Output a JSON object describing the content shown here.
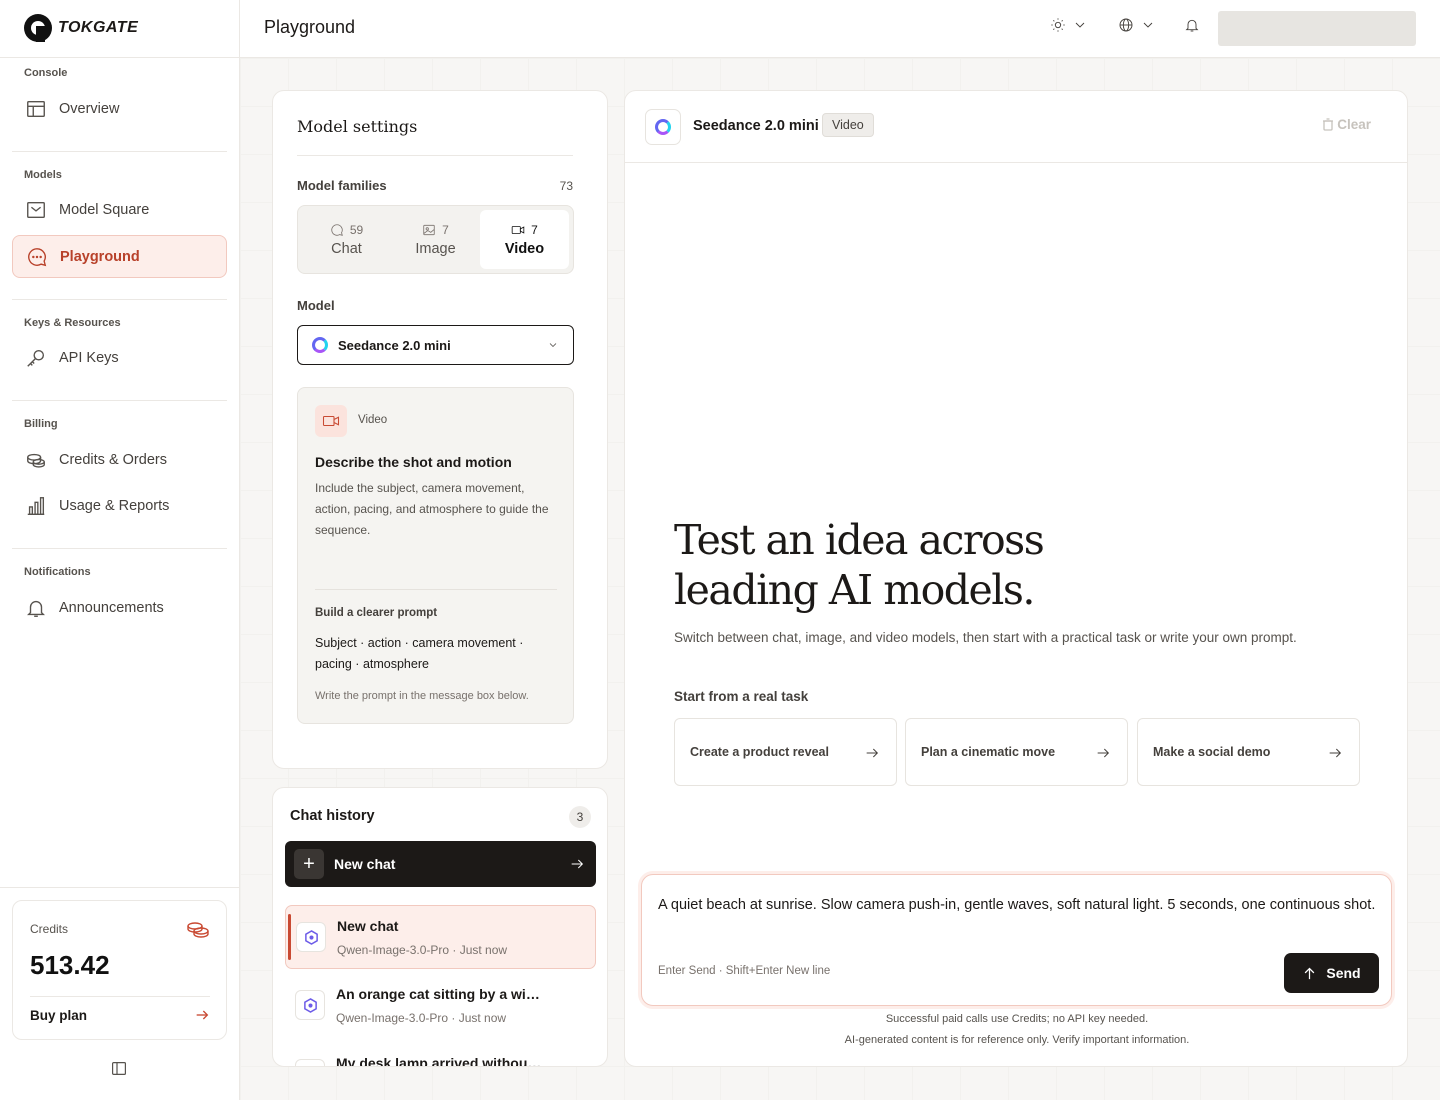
{
  "app": {
    "brand": "TOKGATE"
  },
  "sidebar": {
    "groups": [
      {
        "label": "Console",
        "items": [
          {
            "label": "Overview",
            "icon": "layout-icon"
          }
        ]
      },
      {
        "label": "Models",
        "items": [
          {
            "label": "Model Square",
            "icon": "inbox-icon"
          },
          {
            "label": "Playground",
            "icon": "chat-bubble-icon",
            "active": true
          }
        ]
      },
      {
        "label": "Keys & Resources",
        "items": [
          {
            "label": "API Keys",
            "icon": "key-icon"
          }
        ]
      },
      {
        "label": "Billing",
        "items": [
          {
            "label": "Credits & Orders",
            "icon": "coins-icon"
          },
          {
            "label": "Usage & Reports",
            "icon": "bar-chart-icon"
          }
        ]
      },
      {
        "label": "Notifications",
        "items": [
          {
            "label": "Announcements",
            "icon": "bell-icon"
          }
        ]
      }
    ],
    "credits": {
      "label": "Credits",
      "value": "513.42",
      "buy_label": "Buy plan"
    }
  },
  "header": {
    "title": "Playground"
  },
  "model_settings": {
    "title": "Model settings",
    "families_label": "Model families",
    "families_count": "73",
    "families": [
      {
        "name": "Chat",
        "count": "59",
        "icon": "chat-icon"
      },
      {
        "name": "Image",
        "count": "7",
        "icon": "image-icon"
      },
      {
        "name": "Video",
        "count": "7",
        "icon": "video-icon",
        "active": true
      }
    ],
    "model_label": "Model",
    "selected_model": "Seedance 2.0 mini",
    "info": {
      "tag": "Video",
      "heading": "Describe the shot and motion",
      "description": "Include the subject, camera movement, action, pacing, and atmosphere to guide the sequence.",
      "sub_heading": "Build a clearer prompt",
      "prompt_parts": "Subject · action · camera movement · pacing · atmosphere",
      "note": "Write the prompt in the message box below."
    }
  },
  "chat_history": {
    "title": "Chat history",
    "count": "3",
    "new_chat_label": "New chat",
    "items": [
      {
        "name": "New chat",
        "meta": "Qwen-Image-3.0-Pro · Just now",
        "active": true
      },
      {
        "name": "An orange cat sitting by a window",
        "meta": "Qwen-Image-3.0-Pro · Just now"
      },
      {
        "name": "My desk lamp arrived without a plug",
        "meta": ""
      }
    ]
  },
  "main": {
    "model_name": "Seedance 2.0 mini",
    "model_badge": "Video",
    "clear_label": "Clear",
    "hero_line1": "Test an idea across",
    "hero_line2": "leading AI models.",
    "hero_sub": "Switch between chat, image, and video models, then start with a practical task or write your own prompt.",
    "task_label": "Start from a real task",
    "tasks": [
      "Create a product reveal",
      "Plan a cinematic move",
      "Make a social demo"
    ],
    "composer_value": "A quiet beach at sunrise. Slow camera push-in, gentle waves, soft natural light. 5 seconds, one continuous shot.",
    "composer_hint": "Enter Send · Shift+Enter New line",
    "send_label": "Send",
    "footnote1": "Successful paid calls use Credits; no API key needed.",
    "footnote2": "AI-generated content is for reference only. Verify important information."
  },
  "colors": {
    "accent": "#c94a33",
    "accent_bg": "#fdeeea",
    "dark": "#1c1917"
  }
}
